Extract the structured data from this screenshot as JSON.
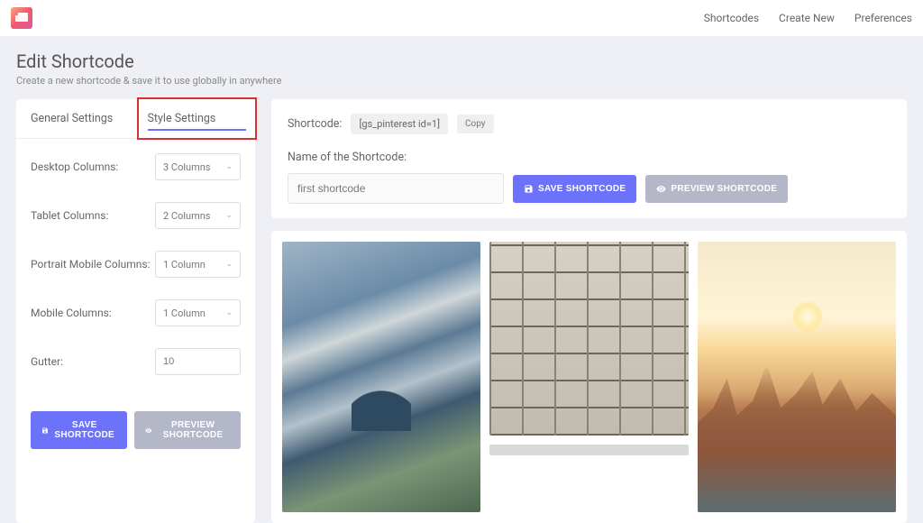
{
  "nav": {
    "shortcodes": "Shortcodes",
    "create_new": "Create New",
    "preferences": "Preferences"
  },
  "header": {
    "title": "Edit Shortcode",
    "subtitle": "Create a new shortcode & save it to use globally in anywhere"
  },
  "tabs": {
    "general": "General Settings",
    "style": "Style Settings"
  },
  "fields": {
    "desktop": {
      "label": "Desktop Columns:",
      "value": "3 Columns"
    },
    "tablet": {
      "label": "Tablet Columns:",
      "value": "2 Columns"
    },
    "portrait": {
      "label": "Portrait Mobile Columns:",
      "value": "1 Column"
    },
    "mobile": {
      "label": "Mobile Columns:",
      "value": "1 Column"
    },
    "gutter": {
      "label": "Gutter:",
      "value": "10"
    }
  },
  "buttons": {
    "save": "SAVE SHORTCODE",
    "preview": "PREVIEW SHORTCODE"
  },
  "main": {
    "shortcode_label": "Shortcode:",
    "shortcode_value": "[gs_pinterest id=1]",
    "copy": "Copy",
    "name_label": "Name of the Shortcode:",
    "name_value": "first shortcode"
  }
}
